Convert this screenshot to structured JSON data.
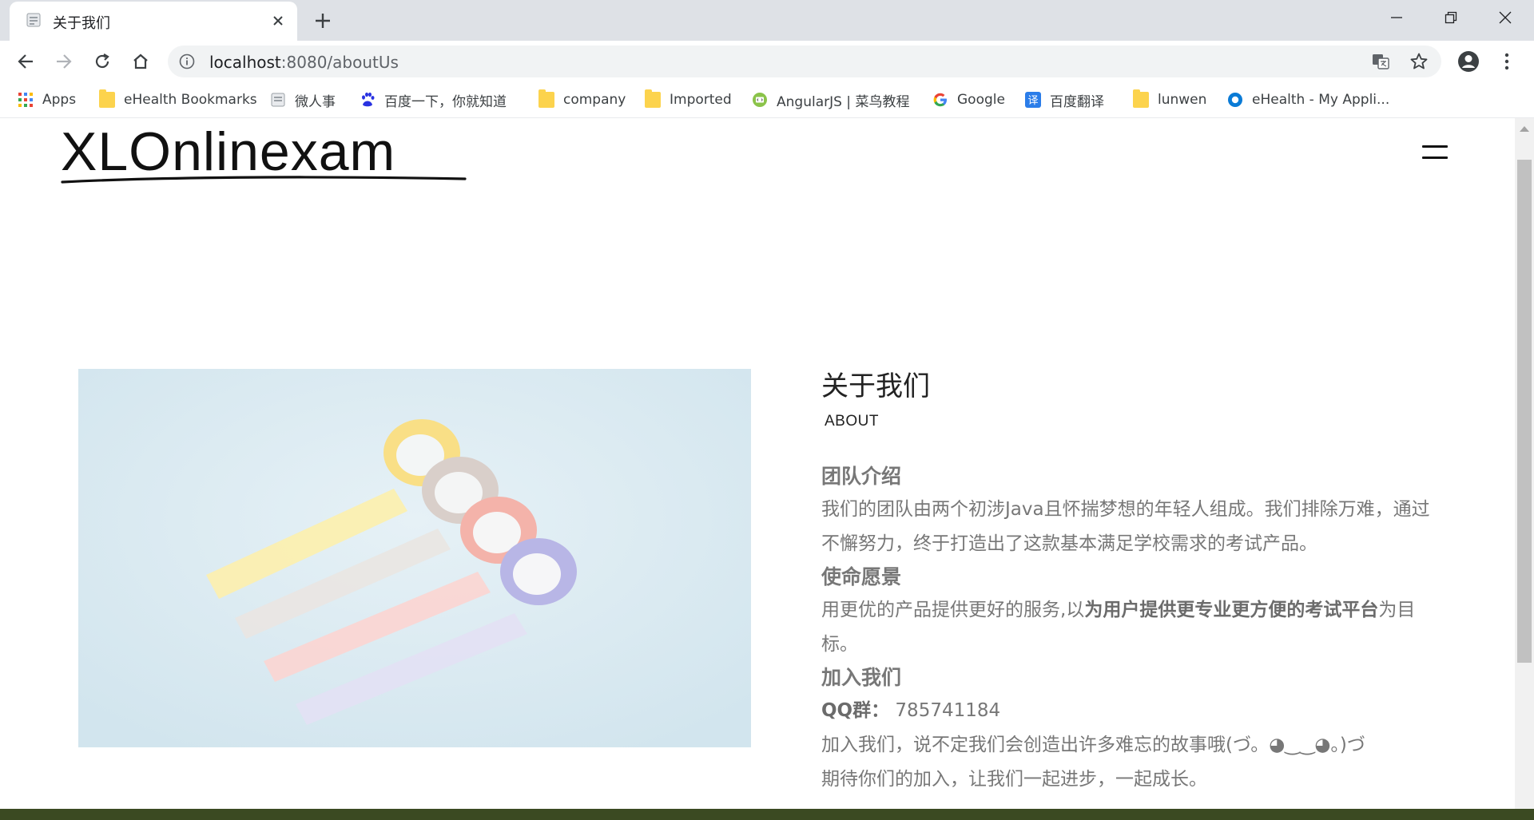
{
  "browser": {
    "tab_title": "关于我们",
    "url_host": "localhost",
    "url_rest": ":8080/aboutUs",
    "bookmarks": [
      {
        "label": "Apps",
        "icon": "apps-grid-icon"
      },
      {
        "label": "eHealth Bookmarks",
        "icon": "folder-icon"
      },
      {
        "label": "微人事",
        "icon": "page-icon"
      },
      {
        "label": "百度一下，你就知道",
        "icon": "baidu-paw-icon"
      },
      {
        "label": "company",
        "icon": "folder-icon"
      },
      {
        "label": "Imported",
        "icon": "folder-icon"
      },
      {
        "label": "AngularJS | 菜鸟教程",
        "icon": "runoob-icon"
      },
      {
        "label": "Google",
        "icon": "google-icon"
      },
      {
        "label": "百度翻译",
        "icon": "baidu-translate-icon"
      },
      {
        "label": "lunwen",
        "icon": "folder-icon"
      },
      {
        "label": "eHealth - My Appli...",
        "icon": "ehealth-icon"
      }
    ]
  },
  "site": {
    "logo": "XLOnlinexam",
    "menu_icon": "hamburger-menu-icon",
    "hero_image": "washi-tape-rolls-image"
  },
  "about": {
    "title": "关于我们",
    "subtitle": "ABOUT",
    "team_heading": "团队介绍",
    "team_text": "我们的团队由两个初涉Java且怀揣梦想的年轻人组成。我们排除万难，通过不懈努力，终于打造出了这款基本满足学校需求的考试产品。",
    "mission_heading": "使命愿景",
    "mission_pre": "用更优的产品提供更好的服务,以",
    "mission_bold": "为用户提供更专业更方便的考试平台",
    "mission_post": "为目标。",
    "join_heading": "加入我们",
    "qq_label": "QQ群：",
    "qq_number": "785741184",
    "join_line1": "加入我们，说不定我们会创造出许多难忘的故事哦(づ。◕‿‿◕。)づ",
    "join_line2": "期待你们的加入，让我们一起进步，一起成长。"
  },
  "colors": {
    "chrome_bg": "#dee1e6",
    "text_gray": "#777777",
    "hero_bg": "#d4e6ef"
  }
}
